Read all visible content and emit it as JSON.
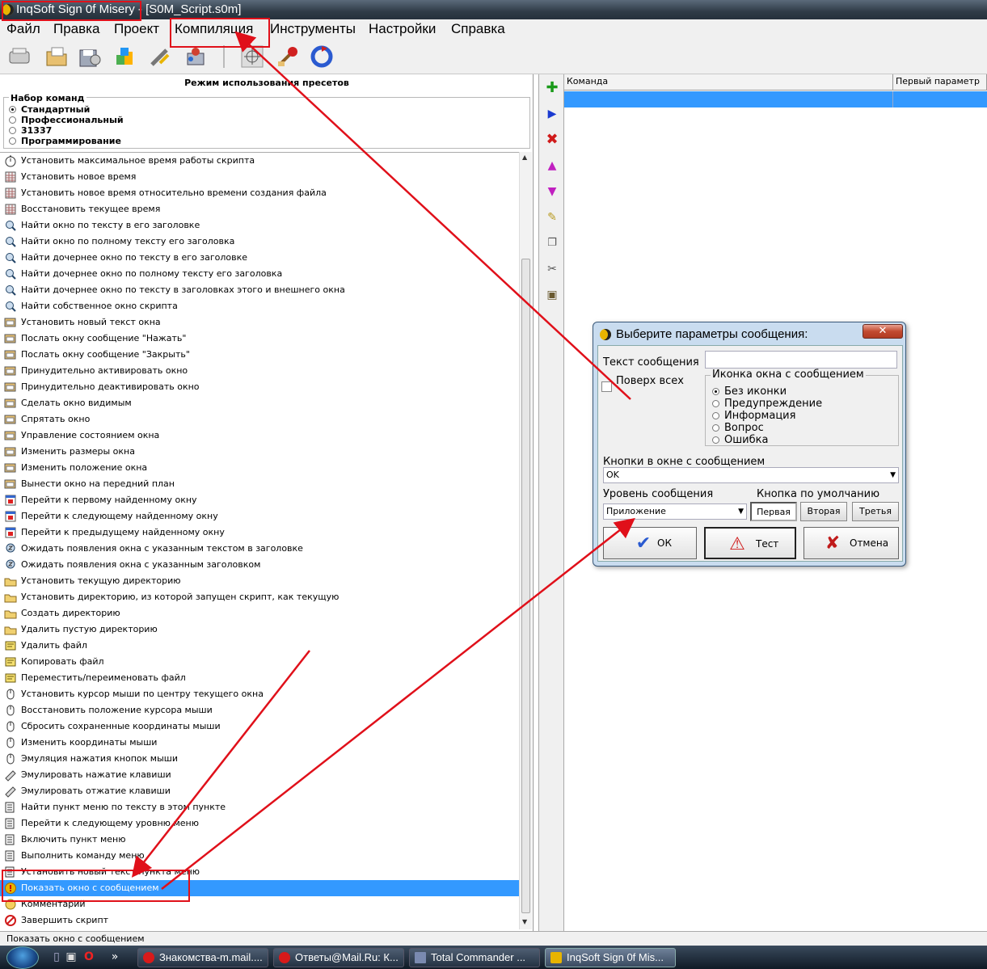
{
  "window": {
    "title": "InqSoft Sign 0f Misery - [S0M_Script.s0m]"
  },
  "menu": {
    "items": [
      "Файл",
      "Правка",
      "Проект",
      "Компиляция",
      "Инструменты",
      "Настройки",
      "Справка"
    ]
  },
  "toolbar": {
    "icons": [
      "open-icon",
      "folder-icon",
      "save-icon",
      "blocks-icon",
      "tools-icon",
      "settings-icon",
      "target-icon",
      "compile-icon",
      "refresh-icon"
    ]
  },
  "left_panel": {
    "preset_title": "Режим использования пресетов",
    "command_set_label": "Набор команд",
    "command_sets": [
      {
        "label": "Стандартный",
        "selected": true
      },
      {
        "label": "Профессиональный",
        "selected": false
      },
      {
        "label": "31337",
        "selected": false
      },
      {
        "label": "Программирование",
        "selected": false
      }
    ],
    "commands": [
      {
        "label": "Установить максимальное время работы скрипта",
        "icon": "stopwatch-icon"
      },
      {
        "label": "Установить новое время",
        "icon": "calendar-icon"
      },
      {
        "label": "Установить новое время относительно времени создания файла",
        "icon": "calendar-icon"
      },
      {
        "label": "Восстановить текущее время",
        "icon": "calendar-icon"
      },
      {
        "label": "Найти окно по тексту в его заголовке",
        "icon": "magnifier-icon"
      },
      {
        "label": "Найти окно по полному тексту его заголовка",
        "icon": "magnifier-icon"
      },
      {
        "label": "Найти дочернее окно по тексту в его заголовке",
        "icon": "magnifier-icon"
      },
      {
        "label": "Найти дочернее окно по полному тексту его заголовка",
        "icon": "magnifier-icon"
      },
      {
        "label": "Найти дочернее окно по тексту в заголовках этого и внешнего окна",
        "icon": "magnifier-icon"
      },
      {
        "label": "Найти собственное окно скрипта",
        "icon": "magnifier-icon"
      },
      {
        "label": "Установить новый текст окна",
        "icon": "window-icon"
      },
      {
        "label": "Послать окну сообщение \"Нажать\"",
        "icon": "window-icon"
      },
      {
        "label": "Послать окну сообщение \"Закрыть\"",
        "icon": "window-icon"
      },
      {
        "label": "Принудительно активировать окно",
        "icon": "window-icon"
      },
      {
        "label": "Принудительно деактивировать окно",
        "icon": "window-icon"
      },
      {
        "label": "Сделать окно видимым",
        "icon": "window-icon"
      },
      {
        "label": "Спрятать окно",
        "icon": "window-icon"
      },
      {
        "label": "Управление состоянием окна",
        "icon": "window-icon"
      },
      {
        "label": "Изменить размеры окна",
        "icon": "window-icon"
      },
      {
        "label": "Изменить положение окна",
        "icon": "window-icon"
      },
      {
        "label": "Вынести окно на передний план",
        "icon": "window-icon"
      },
      {
        "label": "Перейти к первому найденному окну",
        "icon": "window-red-icon"
      },
      {
        "label": "Перейти к следующему найденному окну",
        "icon": "window-red-icon"
      },
      {
        "label": "Перейти к предыдущему найденному окну",
        "icon": "window-red-icon"
      },
      {
        "label": "Ожидать появления окна с указанным текстом в заголовке",
        "icon": "hourglass-search-icon"
      },
      {
        "label": "Ожидать появления окна с указанным заголовком",
        "icon": "hourglass-search-icon"
      },
      {
        "label": "Установить текущую директорию",
        "icon": "folder-icon"
      },
      {
        "label": "Установить директорию, из которой запущен скрипт, как текущую",
        "icon": "folder-icon"
      },
      {
        "label": "Создать директорию",
        "icon": "folder-icon"
      },
      {
        "label": "Удалить пустую директорию",
        "icon": "folder-icon"
      },
      {
        "label": "Удалить файл",
        "icon": "file-icon"
      },
      {
        "label": "Копировать файл",
        "icon": "file-icon"
      },
      {
        "label": "Переместить/переименовать файл",
        "icon": "file-icon"
      },
      {
        "label": "Установить курсор мыши по центру текущего окна",
        "icon": "mouse-icon"
      },
      {
        "label": "Восстановить положение курсора мыши",
        "icon": "mouse-icon"
      },
      {
        "label": "Сбросить сохраненные координаты мыши",
        "icon": "mouse-icon"
      },
      {
        "label": "Изменить координаты мыши",
        "icon": "mouse-icon"
      },
      {
        "label": "Эмуляция нажатия кнопок мыши",
        "icon": "mouse-icon"
      },
      {
        "label": "Эмулировать нажатие клавиши",
        "icon": "keyboard-icon"
      },
      {
        "label": "Эмулировать отжатие клавиши",
        "icon": "keyboard-icon"
      },
      {
        "label": "Найти пункт меню по тексту в этом пункте",
        "icon": "menu-icon"
      },
      {
        "label": "Перейти к следующему уровню меню",
        "icon": "menu-icon"
      },
      {
        "label": "Включить пункт меню",
        "icon": "menu-icon"
      },
      {
        "label": "Выполнить команду меню",
        "icon": "menu-icon"
      },
      {
        "label": "Установить новый текст пункта меню",
        "icon": "menu-icon"
      },
      {
        "label": "Показать окно с сообщением",
        "icon": "message-icon",
        "selected": true
      },
      {
        "label": "Комментарий",
        "icon": "comment-icon"
      },
      {
        "label": "Завершить скрипт",
        "icon": "stop-icon"
      }
    ],
    "status_text": "Показать окно с сообщением"
  },
  "side_tools": [
    "add-icon",
    "run-icon",
    "delete-icon",
    "move-up-icon",
    "move-down-icon",
    "edit-icon",
    "copy-icon",
    "cut-icon",
    "paste-icon"
  ],
  "script_grid": {
    "columns": [
      "Команда",
      "Первый параметр"
    ]
  },
  "dialog": {
    "title": "Выберите параметры сообщения:",
    "close_label": "✕",
    "message_text_label": "Текст сообщения",
    "message_text_value": "",
    "on_top_label": "Поверх всех",
    "icon_group_label": "Иконка окна с сообщением",
    "icon_options": [
      {
        "label": "Без иконки",
        "selected": true
      },
      {
        "label": "Предупреждение",
        "selected": false
      },
      {
        "label": "Информация",
        "selected": false
      },
      {
        "label": "Вопрос",
        "selected": false
      },
      {
        "label": "Ошибка",
        "selected": false
      }
    ],
    "buttons_label": "Кнопки в окне с сообщением",
    "buttons_value": "OK",
    "level_label": "Уровень сообщения",
    "level_value": "Приложение",
    "default_button_label": "Кнопка по умолчанию",
    "default_buttons": [
      "Первая",
      "Вторая",
      "Третья"
    ],
    "ok_label": "ОК",
    "test_label": "Тест",
    "cancel_label": "Отмена"
  },
  "taskbar": {
    "tasks": [
      {
        "label": "Знакомства-m.mail....",
        "icon": "opera-icon"
      },
      {
        "label": "Ответы@Mail.Ru: К...",
        "icon": "opera-icon"
      },
      {
        "label": "Total Commander ...",
        "icon": "floppy-icon"
      },
      {
        "label": "InqSoft Sign 0f Mis...",
        "icon": "app-icon",
        "active": true
      }
    ]
  },
  "colors": {
    "selection": "#3399ff",
    "annotation": "#e0101a",
    "titlebar": "#2f3b47"
  }
}
